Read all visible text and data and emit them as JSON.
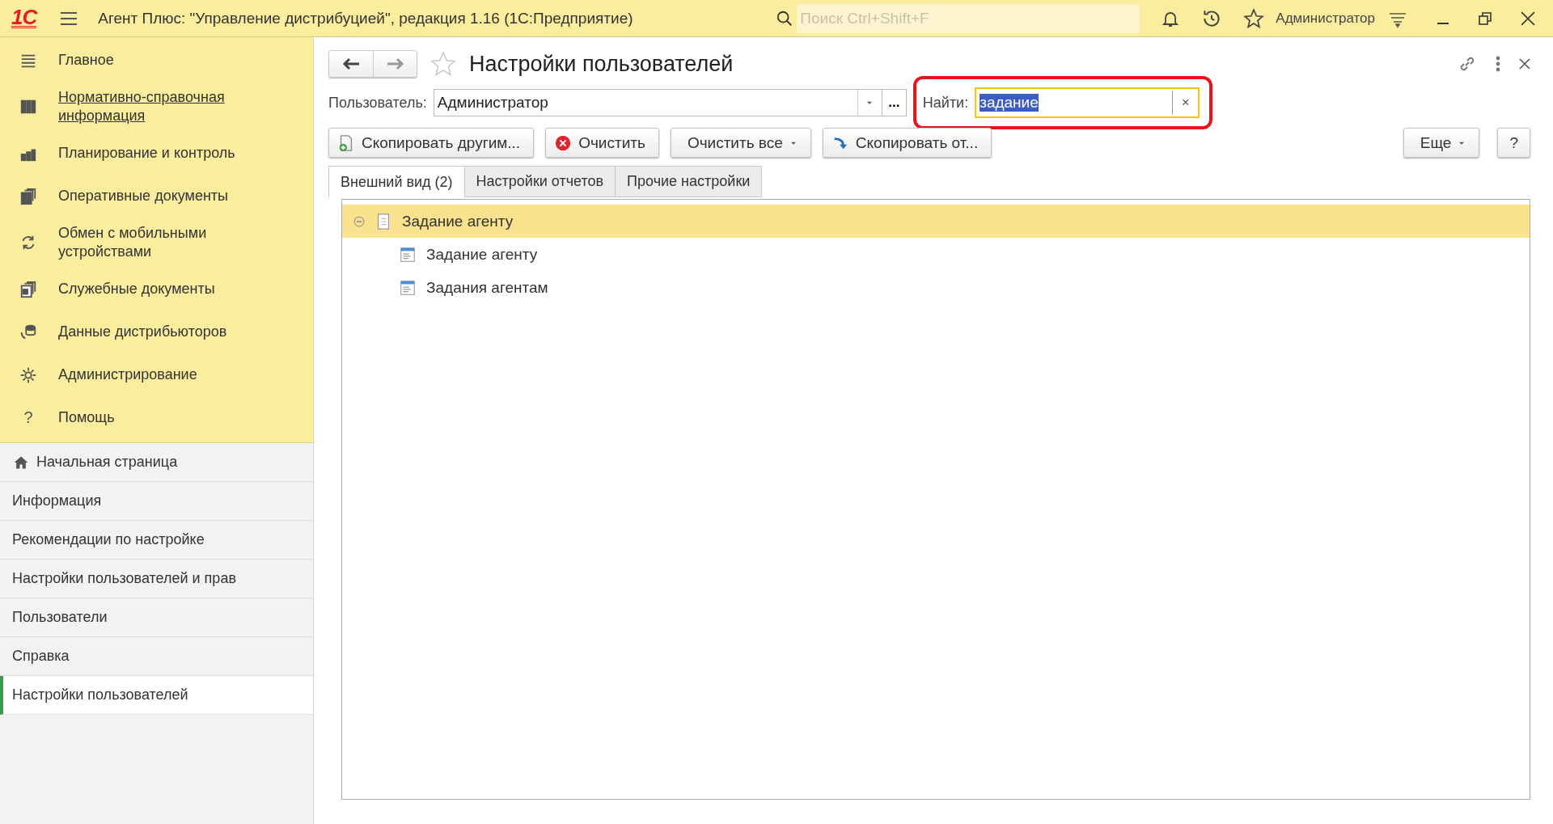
{
  "titlebar": {
    "logo": "1С",
    "title": "Агент Плюс: \"Управление дистрибуцией\", редакция 1.16  (1С:Предприятие)",
    "search": {
      "placeholder": "Поиск Ctrl+Shift+F"
    },
    "user": "Администратор"
  },
  "sidebar": {
    "sections": [
      {
        "label": "Главное",
        "hovered": false
      },
      {
        "label": "Нормативно-справочная информация",
        "hovered": true
      },
      {
        "label": "Планирование и контроль",
        "hovered": false
      },
      {
        "label": "Оперативные документы",
        "hovered": false
      },
      {
        "label": "Обмен с мобильными устройствами",
        "hovered": false
      },
      {
        "label": "Служебные документы",
        "hovered": false
      },
      {
        "label": "Данные дистрибьюторов",
        "hovered": false
      },
      {
        "label": "Администрирование",
        "hovered": false
      },
      {
        "label": "Помощь",
        "hovered": false,
        "kind": "glyph",
        "glyph": "?"
      }
    ],
    "open_windows": [
      {
        "label": "Начальная страница",
        "kind": "home",
        "selected": false
      },
      {
        "label": "Информация",
        "kind": "plain",
        "selected": false
      },
      {
        "label": "Рекомендации по настройке",
        "kind": "plain",
        "selected": false
      },
      {
        "label": "Настройки пользователей и прав",
        "kind": "plain",
        "selected": false
      },
      {
        "label": "Пользователи",
        "kind": "plain",
        "selected": false
      },
      {
        "label": "Справка",
        "kind": "plain",
        "selected": false
      },
      {
        "label": "Настройки пользователей",
        "kind": "plain",
        "selected": true
      }
    ]
  },
  "form": {
    "title": "Настройки пользователей",
    "favorite": false,
    "user_field": {
      "label": "Пользователь:",
      "value": "Администратор",
      "more": "..."
    },
    "find_field": {
      "label": "Найти:",
      "value": "задание",
      "value_selected": true,
      "clear": "×"
    },
    "buttons": [
      {
        "label": "Скопировать другим...",
        "kind": "copy-to"
      },
      {
        "label": "Очистить",
        "kind": "clear"
      },
      {
        "label": "Очистить все",
        "kind": "dropdown"
      },
      {
        "label": "Скопировать от...",
        "kind": "copy-from"
      }
    ],
    "more_button": "Еще",
    "help_button": "?",
    "tabs": [
      {
        "label": "Внешний вид (2)",
        "selected": true
      },
      {
        "label": "Настройки отчетов",
        "selected": false
      },
      {
        "label": "Прочие настройки",
        "selected": false
      }
    ],
    "tree": [
      {
        "label": "Задание агенту",
        "expanded": true,
        "selected": true,
        "children": [
          {
            "label": "Задание агенту",
            "selected": false
          },
          {
            "label": "Задания агентам",
            "selected": false
          }
        ]
      }
    ]
  }
}
